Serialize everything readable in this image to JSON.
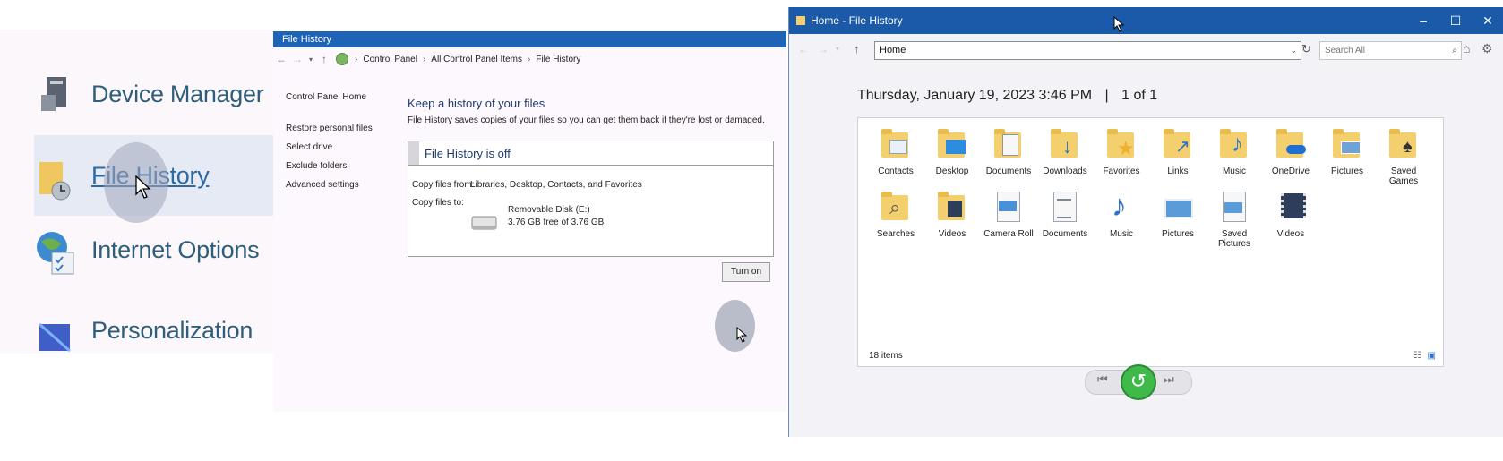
{
  "left_panel": {
    "items": [
      {
        "label": "Device Manager"
      },
      {
        "label": "File History"
      },
      {
        "label": "Internet Options"
      },
      {
        "label": "Personalization"
      }
    ]
  },
  "control_panel": {
    "title": "File History",
    "breadcrumbs": [
      "Control Panel",
      "All Control Panel Items",
      "File History"
    ],
    "nav": {
      "home": "Control Panel Home",
      "links": [
        "Restore personal files",
        "Select drive",
        "Exclude folders",
        "Advanced settings"
      ]
    },
    "heading": "Keep a history of your files",
    "description": "File History saves copies of your files so you can get them back if they're lost or damaged.",
    "status": "File History is off",
    "copy_from_label": "Copy files from:",
    "copy_from_value": "Libraries, Desktop, Contacts, and Favorites",
    "copy_to_label": "Copy files to:",
    "drive_name": "Removable Disk (E:)",
    "drive_free": "3.76 GB free of 3.76 GB",
    "turn_on_label": "Turn on"
  },
  "file_history": {
    "window_title": "Home - File History",
    "address": "Home",
    "search_placeholder": "Search All",
    "date_line": "Thursday, January 19, 2023 3:46 PM",
    "pager": "1 of 1",
    "items": [
      {
        "name": "Contacts",
        "icon": "contacts-folder-icon"
      },
      {
        "name": "Desktop",
        "icon": "desktop-folder-icon"
      },
      {
        "name": "Documents",
        "icon": "documents-folder-icon"
      },
      {
        "name": "Downloads",
        "icon": "downloads-folder-icon"
      },
      {
        "name": "Favorites",
        "icon": "favorites-folder-icon"
      },
      {
        "name": "Links",
        "icon": "links-folder-icon"
      },
      {
        "name": "Music",
        "icon": "music-folder-icon"
      },
      {
        "name": "OneDrive",
        "icon": "onedrive-folder-icon"
      },
      {
        "name": "Pictures",
        "icon": "pictures-folder-icon"
      },
      {
        "name": "Saved Games",
        "icon": "saved-games-folder-icon"
      },
      {
        "name": "Searches",
        "icon": "searches-folder-icon"
      },
      {
        "name": "Videos",
        "icon": "videos-folder-icon"
      },
      {
        "name": "Camera Roll",
        "icon": "camera-roll-library-icon"
      },
      {
        "name": "Documents",
        "icon": "documents-library-icon"
      },
      {
        "name": "Music",
        "icon": "music-library-icon"
      },
      {
        "name": "Pictures",
        "icon": "pictures-library-icon"
      },
      {
        "name": "Saved Pictures",
        "icon": "saved-pictures-library-icon"
      },
      {
        "name": "Videos",
        "icon": "videos-library-icon"
      }
    ],
    "item_count": "18 items"
  },
  "colors": {
    "title_bar": "#1a5aa8",
    "restore_button": "#3fb94a"
  }
}
